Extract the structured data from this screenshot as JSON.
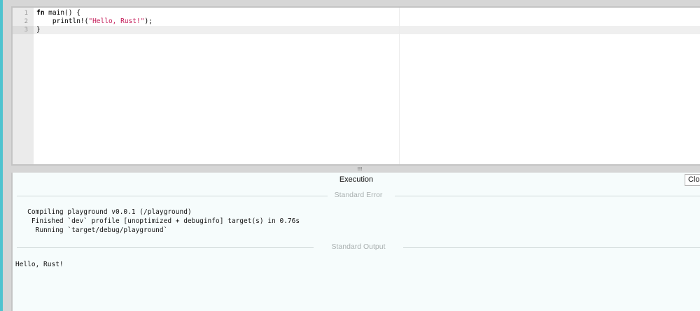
{
  "editor": {
    "line_numbers": [
      "1",
      "2",
      "3"
    ],
    "code": {
      "line1_kw": "fn",
      "line1_rest": " main() {",
      "line2_pre": "    println!(",
      "line2_str": "\"Hello, Rust!\"",
      "line2_post": ");",
      "line3": "}"
    }
  },
  "output": {
    "title": "Execution",
    "close_label": "Close",
    "stderr_label": "Standard Error",
    "stderr_lines": [
      "   Compiling playground v0.0.1 (/playground)",
      "    Finished `dev` profile [unoptimized + debuginfo] target(s) in 0.76s",
      "     Running `target/debug/playground`"
    ],
    "stdout_label": "Standard Output",
    "stdout_lines": [
      "Hello, Rust!"
    ]
  },
  "colors": {
    "accent": "#4fc3cf",
    "string": "#c41a57",
    "output_bg": "#f6fcfc"
  }
}
